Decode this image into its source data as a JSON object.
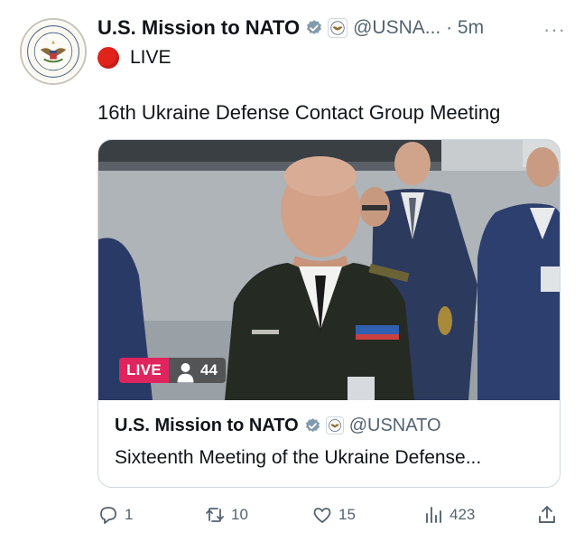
{
  "account": {
    "display_name": "U.S. Mission to NATO",
    "handle_time": "@USNA... · 5m",
    "avatar_icon": "embassy-seal-icon"
  },
  "status": {
    "live_label": "LIVE"
  },
  "post": {
    "text": "16th Ukraine Defense Contact Group Meeting"
  },
  "card": {
    "live_badge": "LIVE",
    "viewers": "44",
    "account_name": "U.S. Mission to NATO",
    "account_handle": "@USNATO",
    "title": "Sixteenth Meeting of the Ukraine Defense..."
  },
  "actions": {
    "replies": "1",
    "reposts": "10",
    "likes": "15",
    "views": "423"
  },
  "colors": {
    "live_red": "#e0241c",
    "live_pill": "#e0245e",
    "verified_gray": "#829aab",
    "text_secondary": "#536471"
  }
}
